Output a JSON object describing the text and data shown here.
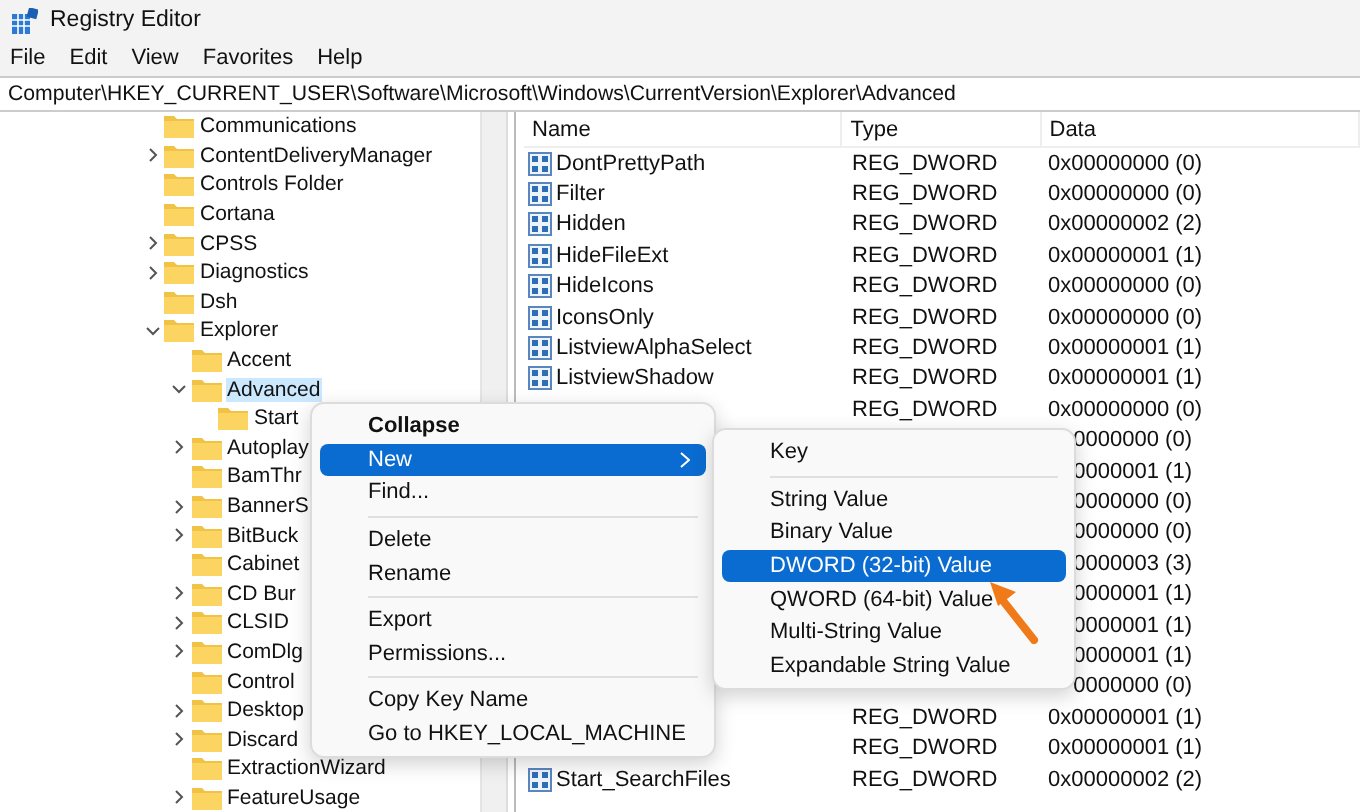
{
  "window": {
    "title": "Registry Editor"
  },
  "menu_bar": [
    "File",
    "Edit",
    "View",
    "Favorites",
    "Help"
  ],
  "address": "Computer\\HKEY_CURRENT_USER\\Software\\Microsoft\\Windows\\CurrentVersion\\Explorer\\Advanced",
  "tree": [
    {
      "label": "Communications",
      "selected": false
    },
    {
      "label": "ContentDeliveryManager",
      "expanded": false,
      "selected": false
    },
    {
      "label": "Controls Folder",
      "selected": false
    },
    {
      "label": "Cortana",
      "selected": false
    },
    {
      "label": "CPSS",
      "expanded": false,
      "selected": false
    },
    {
      "label": "Diagnostics",
      "expanded": false,
      "selected": false
    },
    {
      "label": "Dsh",
      "selected": false
    },
    {
      "label": "Explorer",
      "expanded": true,
      "selected": false,
      "children": [
        {
          "label": "Accent",
          "selected": false
        },
        {
          "label": "Advanced",
          "expanded": true,
          "selected": true,
          "children": [
            {
              "label": "Start",
              "selected": false
            }
          ]
        },
        {
          "label": "Autoplay",
          "expanded": false,
          "selected": false
        },
        {
          "label": "BamThr",
          "selected": false
        },
        {
          "label": "BannerS",
          "expanded": false,
          "selected": false
        },
        {
          "label": "BitBuck",
          "expanded": false,
          "selected": false
        },
        {
          "label": "Cabinet",
          "selected": false
        },
        {
          "label": "CD Bur",
          "expanded": false,
          "selected": false
        },
        {
          "label": "CLSID",
          "expanded": false,
          "selected": false
        },
        {
          "label": "ComDlg",
          "expanded": false,
          "selected": false
        },
        {
          "label": "Control",
          "selected": false
        },
        {
          "label": "Desktop",
          "expanded": false,
          "selected": false
        },
        {
          "label": "Discard",
          "expanded": false,
          "selected": false
        },
        {
          "label": "ExtractionWizard",
          "selected": false
        },
        {
          "label": "FeatureUsage",
          "expanded": false,
          "selected": false
        }
      ]
    }
  ],
  "values": {
    "columns": [
      "Name",
      "Type",
      "Data"
    ],
    "rows": [
      {
        "name": "DontPrettyPath",
        "type": "REG_DWORD",
        "data": "0x00000000 (0)"
      },
      {
        "name": "Filter",
        "type": "REG_DWORD",
        "data": "0x00000000 (0)"
      },
      {
        "name": "Hidden",
        "type": "REG_DWORD",
        "data": "0x00000002 (2)"
      },
      {
        "name": "HideFileExt",
        "type": "REG_DWORD",
        "data": "0x00000001 (1)"
      },
      {
        "name": "HideIcons",
        "type": "REG_DWORD",
        "data": "0x00000000 (0)"
      },
      {
        "name": "IconsOnly",
        "type": "REG_DWORD",
        "data": "0x00000000 (0)"
      },
      {
        "name": "ListviewAlphaSelect",
        "type": "REG_DWORD",
        "data": "0x00000001 (1)"
      },
      {
        "name": "ListviewShadow",
        "type": "REG_DWORD",
        "data": "0x00000001 (1)"
      },
      {
        "type": "REG_DWORD",
        "data": "0x00000000 (0)"
      },
      {
        "data": "0000000 (0)"
      },
      {
        "data": "0000001 (1)"
      },
      {
        "data": "0000000 (0)"
      },
      {
        "data": "0000000 (0)"
      },
      {
        "data": "0000003 (3)"
      },
      {
        "data": "0000001 (1)"
      },
      {
        "data": "0000001 (1)"
      },
      {
        "data": "0000001 (1)"
      },
      {
        "data": "0000000 (0)"
      },
      {
        "type": "REG_DWORD",
        "data": "0x00000001 (1)"
      },
      {
        "type": "REG_DWORD",
        "data": "0x00000001 (1)"
      },
      {
        "name": "Start_SearchFiles",
        "type": "REG_DWORD",
        "data": "0x00000002 (2)"
      }
    ]
  },
  "context_menu": [
    {
      "kind": "item",
      "label": "Collapse",
      "default": true,
      "selected": false
    },
    {
      "kind": "item",
      "label": "New",
      "selected": true,
      "submenu": true
    },
    {
      "kind": "item",
      "label": "Find...",
      "selected": false
    },
    {
      "kind": "separator"
    },
    {
      "kind": "item",
      "label": "Delete",
      "selected": false
    },
    {
      "kind": "item",
      "label": "Rename",
      "selected": false
    },
    {
      "kind": "separator"
    },
    {
      "kind": "item",
      "label": "Export",
      "selected": false
    },
    {
      "kind": "item",
      "label": "Permissions...",
      "selected": false
    },
    {
      "kind": "separator"
    },
    {
      "kind": "item",
      "label": "Copy Key Name",
      "selected": false
    },
    {
      "kind": "item",
      "label": "Go to HKEY_LOCAL_MACHINE",
      "selected": false
    }
  ],
  "submenu": [
    {
      "kind": "item",
      "label": "Key",
      "selected": false
    },
    {
      "kind": "separator"
    },
    {
      "kind": "item",
      "label": "String Value",
      "selected": false
    },
    {
      "kind": "item",
      "label": "Binary Value",
      "selected": false
    },
    {
      "kind": "item",
      "label": "DWORD (32-bit) Value",
      "selected": true
    },
    {
      "kind": "item",
      "label": "QWORD (64-bit) Value",
      "selected": false
    },
    {
      "kind": "item",
      "label": "Multi-String Value",
      "selected": false
    },
    {
      "kind": "item",
      "label": "Expandable String Value",
      "selected": false
    }
  ]
}
